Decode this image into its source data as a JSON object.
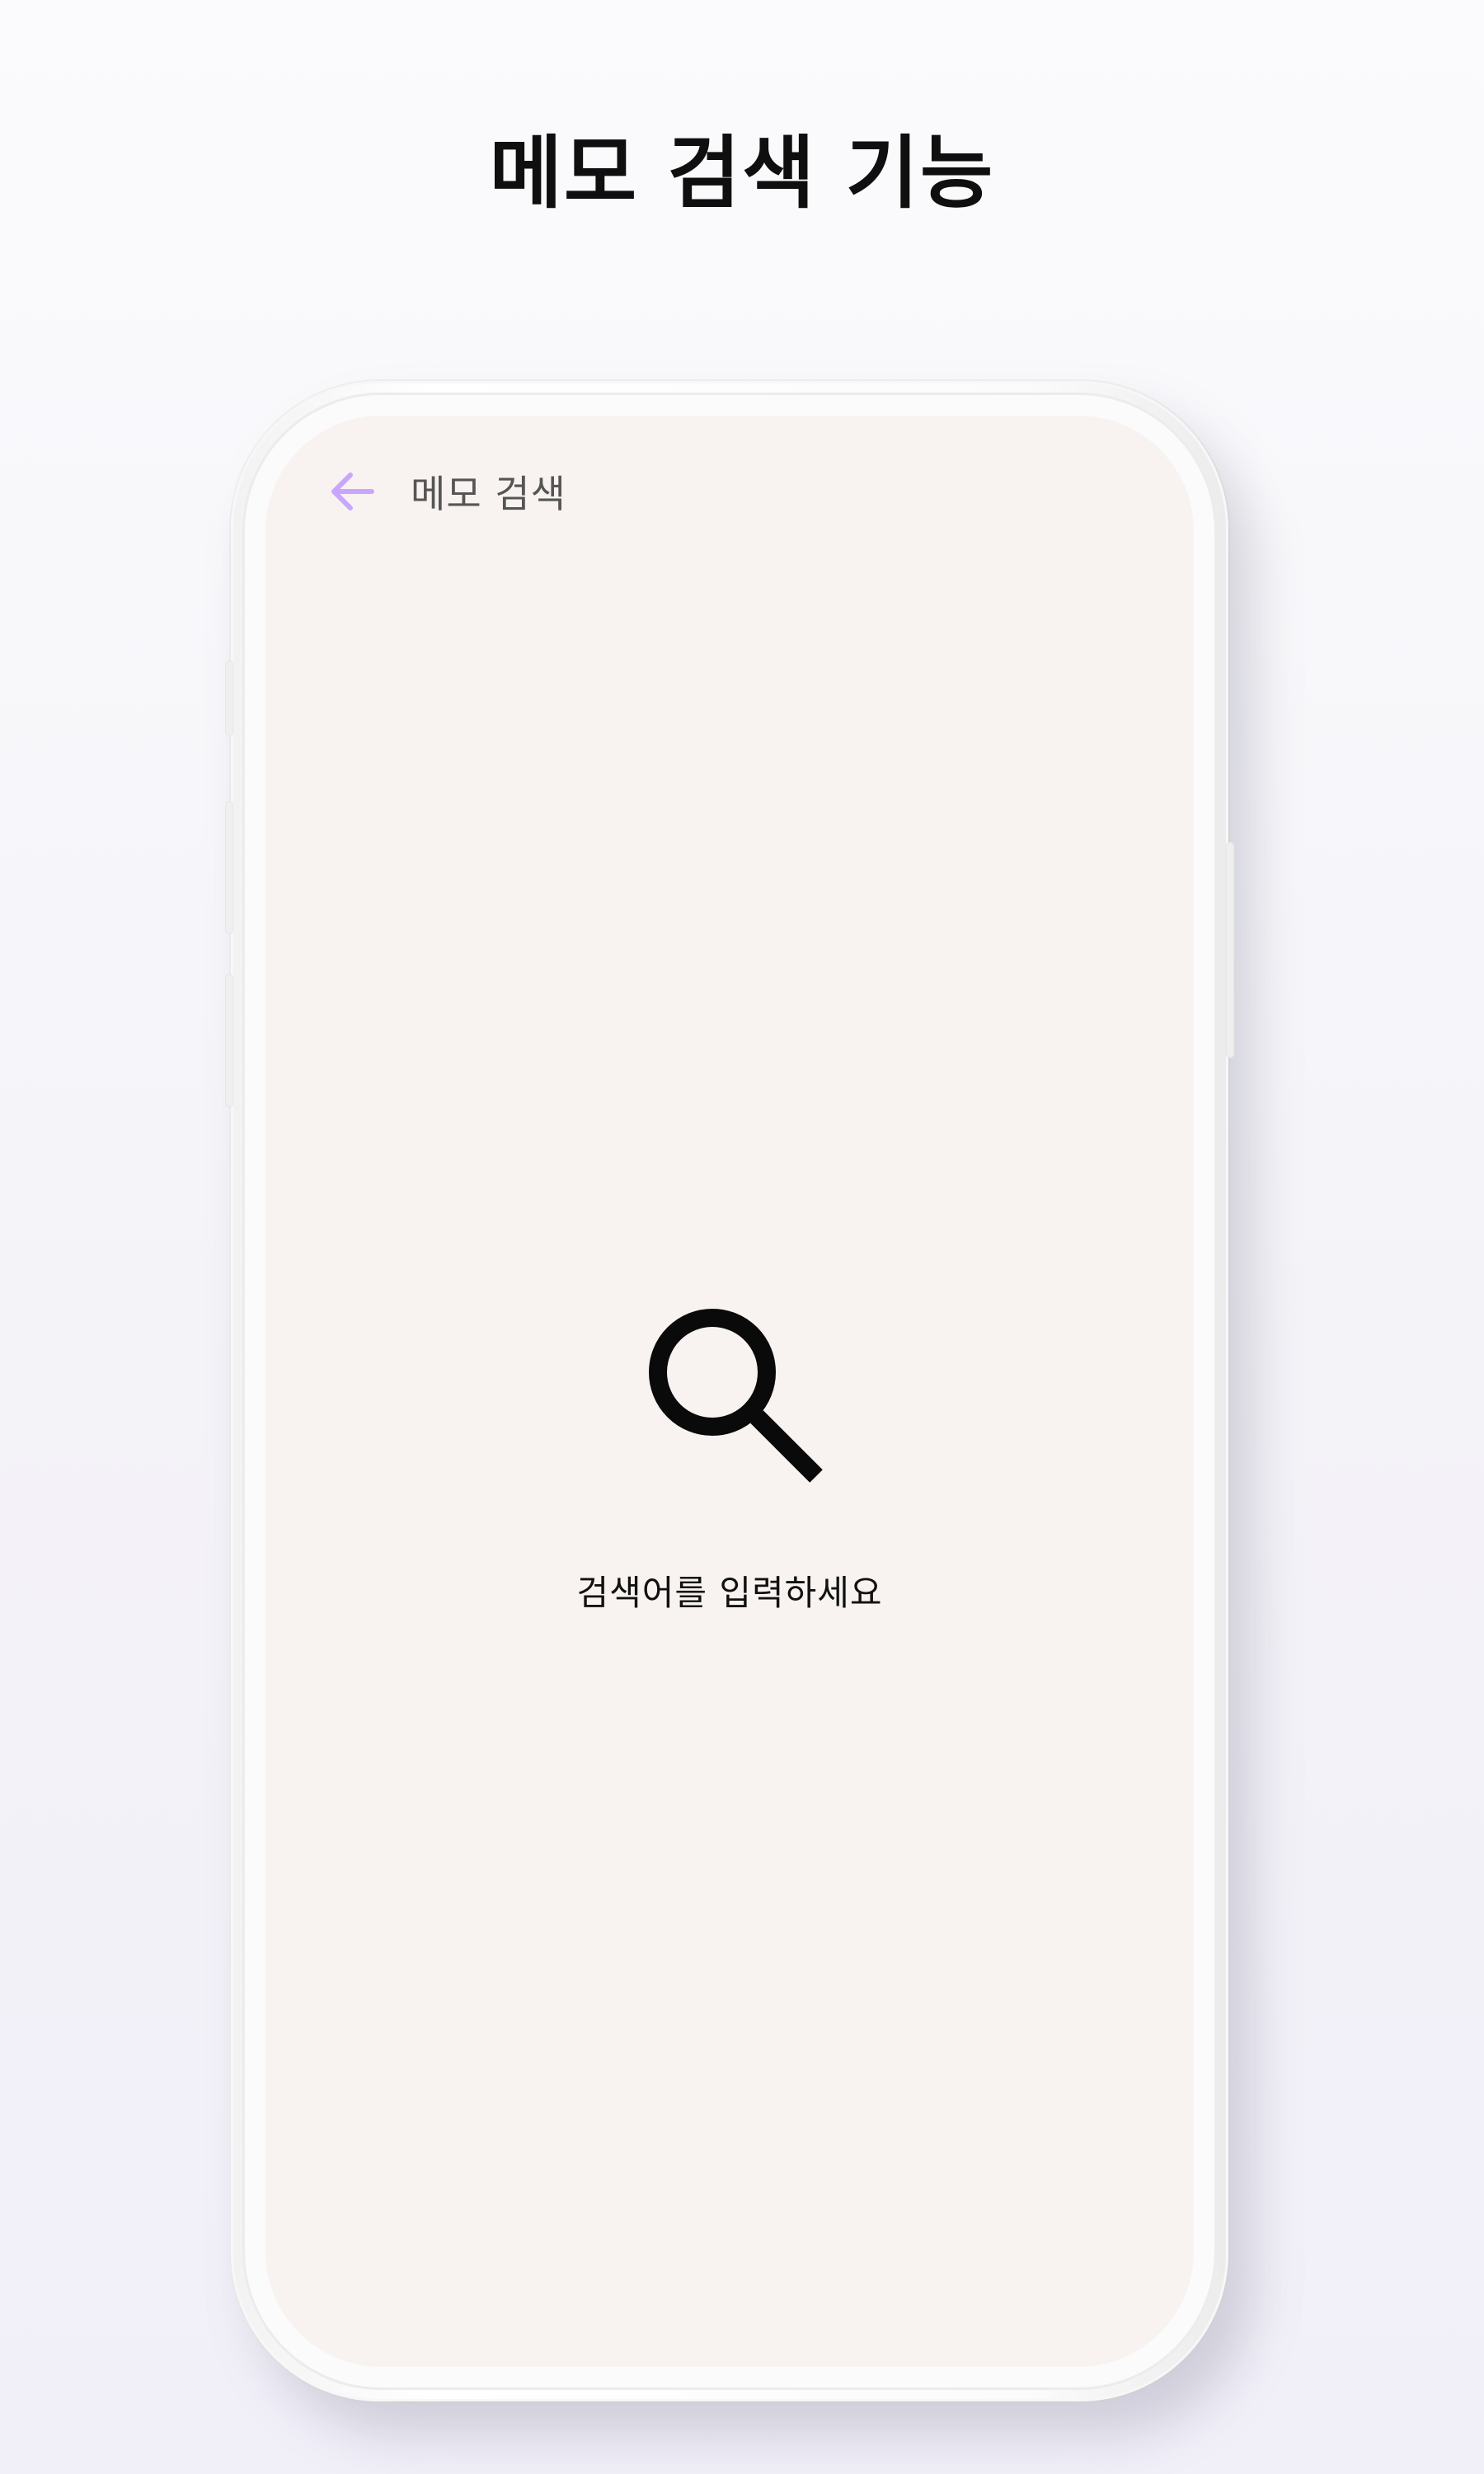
{
  "promo": {
    "title": "메모 검색 기능"
  },
  "app": {
    "header": {
      "back_icon": "arrow-left-icon",
      "title": "메모 검색"
    },
    "empty_state": {
      "icon": "search-icon",
      "message": "검색어를 입력하세요"
    }
  },
  "colors": {
    "accent": "#c8a6ff",
    "screen_background": "#f8f3f0",
    "text_primary": "#111111",
    "text_secondary": "#555555"
  }
}
